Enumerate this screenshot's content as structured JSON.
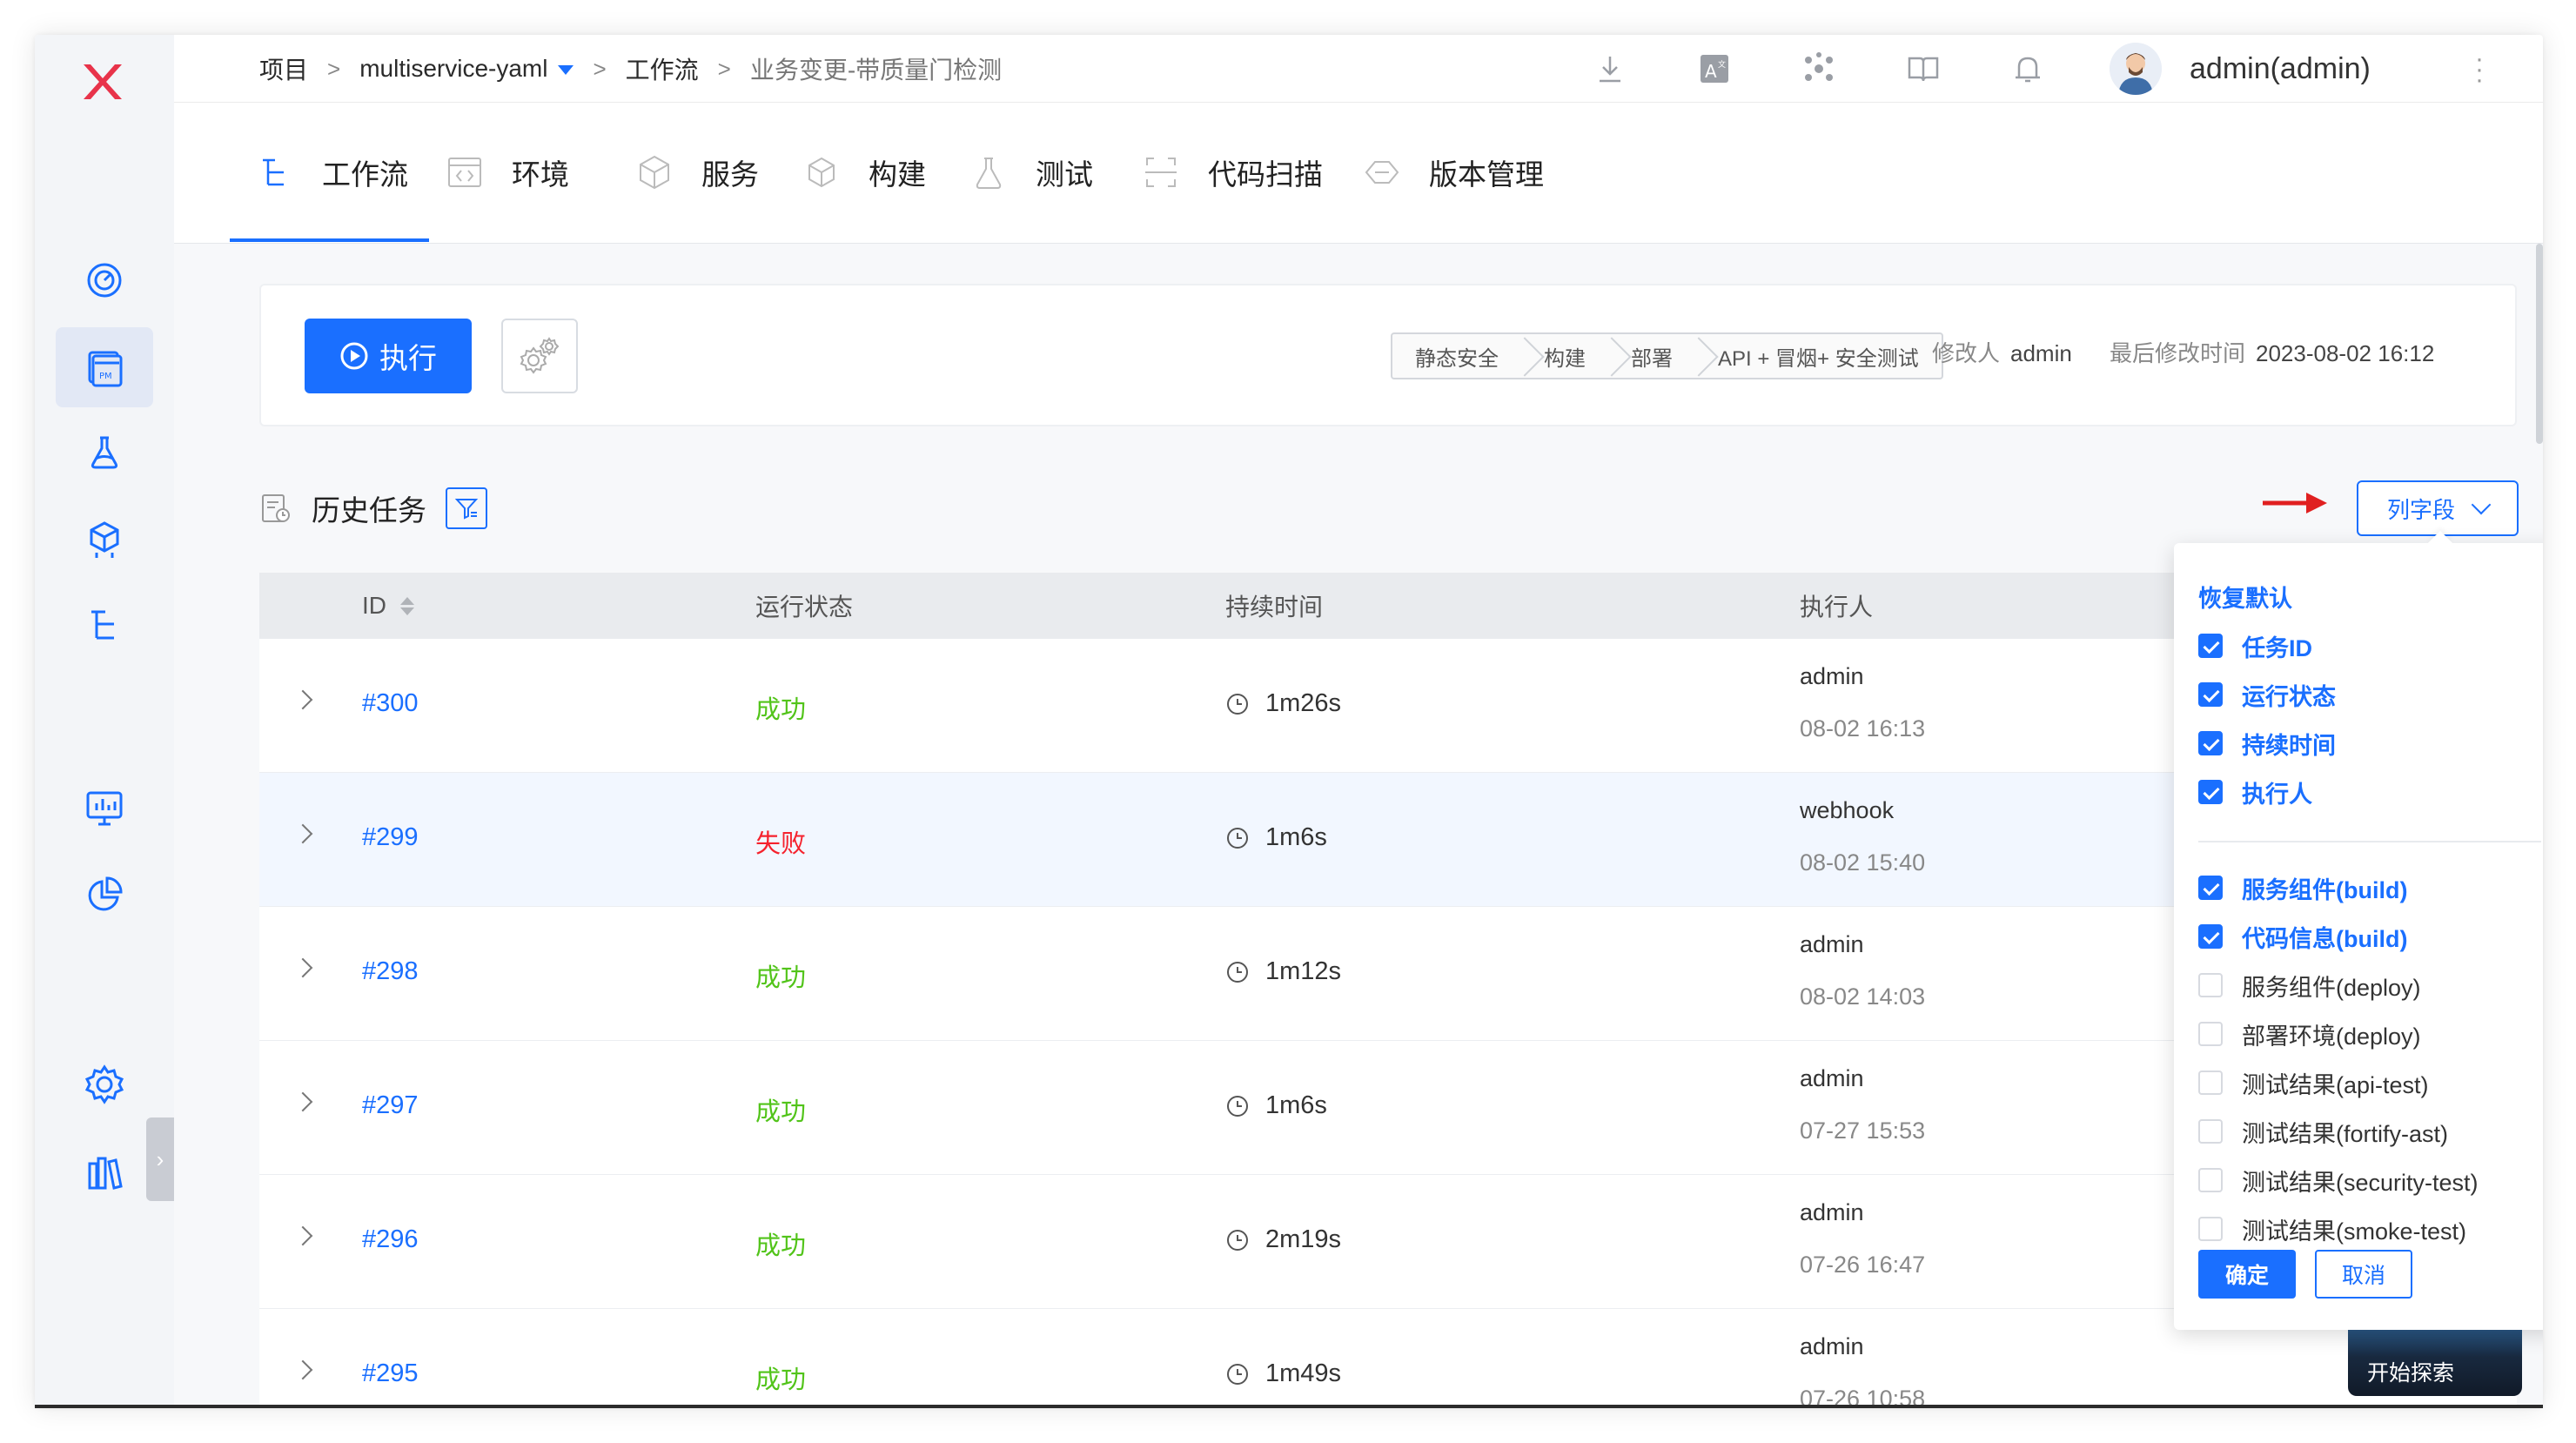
{
  "breadcrumb": {
    "project": "项目",
    "sep": ">",
    "project_name": "multiservice-yaml",
    "workflows": "工作流",
    "current": "业务变更-带质量门检测"
  },
  "user": {
    "name": "admin(admin)"
  },
  "tabs": [
    {
      "label": "工作流",
      "icon": "workflow-icon"
    },
    {
      "label": "环境",
      "icon": "environment-icon"
    },
    {
      "label": "服务",
      "icon": "service-icon"
    },
    {
      "label": "构建",
      "icon": "build-icon"
    },
    {
      "label": "测试",
      "icon": "test-flask-icon"
    },
    {
      "label": "代码扫描",
      "icon": "scan-icon"
    },
    {
      "label": "版本管理",
      "icon": "version-icon"
    }
  ],
  "actions": {
    "run_label": "执行"
  },
  "stages": [
    "静态安全",
    "构建",
    "部署",
    "API + 冒烟+ 安全测试"
  ],
  "meta": {
    "modifier_label": "修改人",
    "modifier": "admin",
    "modtime_label": "最后修改时间",
    "modtime": "2023-08-02 16:12"
  },
  "history": {
    "title": "历史任务",
    "column_button": "列字段"
  },
  "table": {
    "headers": {
      "id": "ID",
      "status": "运行状态",
      "duration": "持续时间",
      "executor": "执行人"
    },
    "rows": [
      {
        "id": "#300",
        "status": "成功",
        "state": "ok",
        "duration": "1m26s",
        "executor": "admin",
        "time": "08-02 16:13"
      },
      {
        "id": "#299",
        "status": "失败",
        "state": "fail",
        "duration": "1m6s",
        "executor": "webhook",
        "time": "08-02 15:40"
      },
      {
        "id": "#298",
        "status": "成功",
        "state": "ok",
        "duration": "1m12s",
        "executor": "admin",
        "time": "08-02 14:03"
      },
      {
        "id": "#297",
        "status": "成功",
        "state": "ok",
        "duration": "1m6s",
        "executor": "admin",
        "time": "07-27 15:53"
      },
      {
        "id": "#296",
        "status": "成功",
        "state": "ok",
        "duration": "2m19s",
        "executor": "admin",
        "time": "07-26 16:47"
      },
      {
        "id": "#295",
        "status": "成功",
        "state": "ok",
        "duration": "1m49s",
        "executor": "admin",
        "time": "07-26 10:58"
      }
    ]
  },
  "dropdown": {
    "reset": "恢复默认",
    "items": [
      {
        "label": "任务ID",
        "checked": true
      },
      {
        "label": "运行状态",
        "checked": true
      },
      {
        "label": "持续时间",
        "checked": true
      },
      {
        "label": "执行人",
        "checked": true
      },
      {
        "label": "服务组件(build)",
        "checked": true
      },
      {
        "label": "代码信息(build)",
        "checked": true
      },
      {
        "label": "服务组件(deploy)",
        "checked": false
      },
      {
        "label": "部署环境(deploy)",
        "checked": false
      },
      {
        "label": "测试结果(api-test)",
        "checked": false
      },
      {
        "label": "测试结果(fortify-ast)",
        "checked": false
      },
      {
        "label": "测试结果(security-test)",
        "checked": false
      },
      {
        "label": "测试结果(smoke-test)",
        "checked": false
      }
    ],
    "ok": "确定",
    "cancel": "取消"
  },
  "explore": {
    "label": "开始探索"
  },
  "colors": {
    "accent": "#1a6fff",
    "success": "#52c41a",
    "fail": "#f5222d",
    "brand": "#e8334a"
  }
}
